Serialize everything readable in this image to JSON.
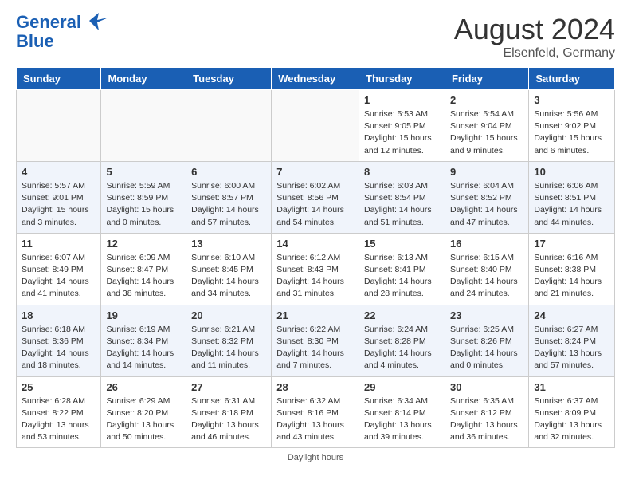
{
  "header": {
    "logo_line1": "General",
    "logo_line2": "Blue",
    "month_year": "August 2024",
    "location": "Elsenfeld, Germany"
  },
  "days_of_week": [
    "Sunday",
    "Monday",
    "Tuesday",
    "Wednesday",
    "Thursday",
    "Friday",
    "Saturday"
  ],
  "weeks": [
    [
      {
        "day": "",
        "detail": ""
      },
      {
        "day": "",
        "detail": ""
      },
      {
        "day": "",
        "detail": ""
      },
      {
        "day": "",
        "detail": ""
      },
      {
        "day": "1",
        "detail": "Sunrise: 5:53 AM\nSunset: 9:05 PM\nDaylight: 15 hours\nand 12 minutes."
      },
      {
        "day": "2",
        "detail": "Sunrise: 5:54 AM\nSunset: 9:04 PM\nDaylight: 15 hours\nand 9 minutes."
      },
      {
        "day": "3",
        "detail": "Sunrise: 5:56 AM\nSunset: 9:02 PM\nDaylight: 15 hours\nand 6 minutes."
      }
    ],
    [
      {
        "day": "4",
        "detail": "Sunrise: 5:57 AM\nSunset: 9:01 PM\nDaylight: 15 hours\nand 3 minutes."
      },
      {
        "day": "5",
        "detail": "Sunrise: 5:59 AM\nSunset: 8:59 PM\nDaylight: 15 hours\nand 0 minutes."
      },
      {
        "day": "6",
        "detail": "Sunrise: 6:00 AM\nSunset: 8:57 PM\nDaylight: 14 hours\nand 57 minutes."
      },
      {
        "day": "7",
        "detail": "Sunrise: 6:02 AM\nSunset: 8:56 PM\nDaylight: 14 hours\nand 54 minutes."
      },
      {
        "day": "8",
        "detail": "Sunrise: 6:03 AM\nSunset: 8:54 PM\nDaylight: 14 hours\nand 51 minutes."
      },
      {
        "day": "9",
        "detail": "Sunrise: 6:04 AM\nSunset: 8:52 PM\nDaylight: 14 hours\nand 47 minutes."
      },
      {
        "day": "10",
        "detail": "Sunrise: 6:06 AM\nSunset: 8:51 PM\nDaylight: 14 hours\nand 44 minutes."
      }
    ],
    [
      {
        "day": "11",
        "detail": "Sunrise: 6:07 AM\nSunset: 8:49 PM\nDaylight: 14 hours\nand 41 minutes."
      },
      {
        "day": "12",
        "detail": "Sunrise: 6:09 AM\nSunset: 8:47 PM\nDaylight: 14 hours\nand 38 minutes."
      },
      {
        "day": "13",
        "detail": "Sunrise: 6:10 AM\nSunset: 8:45 PM\nDaylight: 14 hours\nand 34 minutes."
      },
      {
        "day": "14",
        "detail": "Sunrise: 6:12 AM\nSunset: 8:43 PM\nDaylight: 14 hours\nand 31 minutes."
      },
      {
        "day": "15",
        "detail": "Sunrise: 6:13 AM\nSunset: 8:41 PM\nDaylight: 14 hours\nand 28 minutes."
      },
      {
        "day": "16",
        "detail": "Sunrise: 6:15 AM\nSunset: 8:40 PM\nDaylight: 14 hours\nand 24 minutes."
      },
      {
        "day": "17",
        "detail": "Sunrise: 6:16 AM\nSunset: 8:38 PM\nDaylight: 14 hours\nand 21 minutes."
      }
    ],
    [
      {
        "day": "18",
        "detail": "Sunrise: 6:18 AM\nSunset: 8:36 PM\nDaylight: 14 hours\nand 18 minutes."
      },
      {
        "day": "19",
        "detail": "Sunrise: 6:19 AM\nSunset: 8:34 PM\nDaylight: 14 hours\nand 14 minutes."
      },
      {
        "day": "20",
        "detail": "Sunrise: 6:21 AM\nSunset: 8:32 PM\nDaylight: 14 hours\nand 11 minutes."
      },
      {
        "day": "21",
        "detail": "Sunrise: 6:22 AM\nSunset: 8:30 PM\nDaylight: 14 hours\nand 7 minutes."
      },
      {
        "day": "22",
        "detail": "Sunrise: 6:24 AM\nSunset: 8:28 PM\nDaylight: 14 hours\nand 4 minutes."
      },
      {
        "day": "23",
        "detail": "Sunrise: 6:25 AM\nSunset: 8:26 PM\nDaylight: 14 hours\nand 0 minutes."
      },
      {
        "day": "24",
        "detail": "Sunrise: 6:27 AM\nSunset: 8:24 PM\nDaylight: 13 hours\nand 57 minutes."
      }
    ],
    [
      {
        "day": "25",
        "detail": "Sunrise: 6:28 AM\nSunset: 8:22 PM\nDaylight: 13 hours\nand 53 minutes."
      },
      {
        "day": "26",
        "detail": "Sunrise: 6:29 AM\nSunset: 8:20 PM\nDaylight: 13 hours\nand 50 minutes."
      },
      {
        "day": "27",
        "detail": "Sunrise: 6:31 AM\nSunset: 8:18 PM\nDaylight: 13 hours\nand 46 minutes."
      },
      {
        "day": "28",
        "detail": "Sunrise: 6:32 AM\nSunset: 8:16 PM\nDaylight: 13 hours\nand 43 minutes."
      },
      {
        "day": "29",
        "detail": "Sunrise: 6:34 AM\nSunset: 8:14 PM\nDaylight: 13 hours\nand 39 minutes."
      },
      {
        "day": "30",
        "detail": "Sunrise: 6:35 AM\nSunset: 8:12 PM\nDaylight: 13 hours\nand 36 minutes."
      },
      {
        "day": "31",
        "detail": "Sunrise: 6:37 AM\nSunset: 8:09 PM\nDaylight: 13 hours\nand 32 minutes."
      }
    ]
  ],
  "footer": {
    "daylight_label": "Daylight hours"
  }
}
